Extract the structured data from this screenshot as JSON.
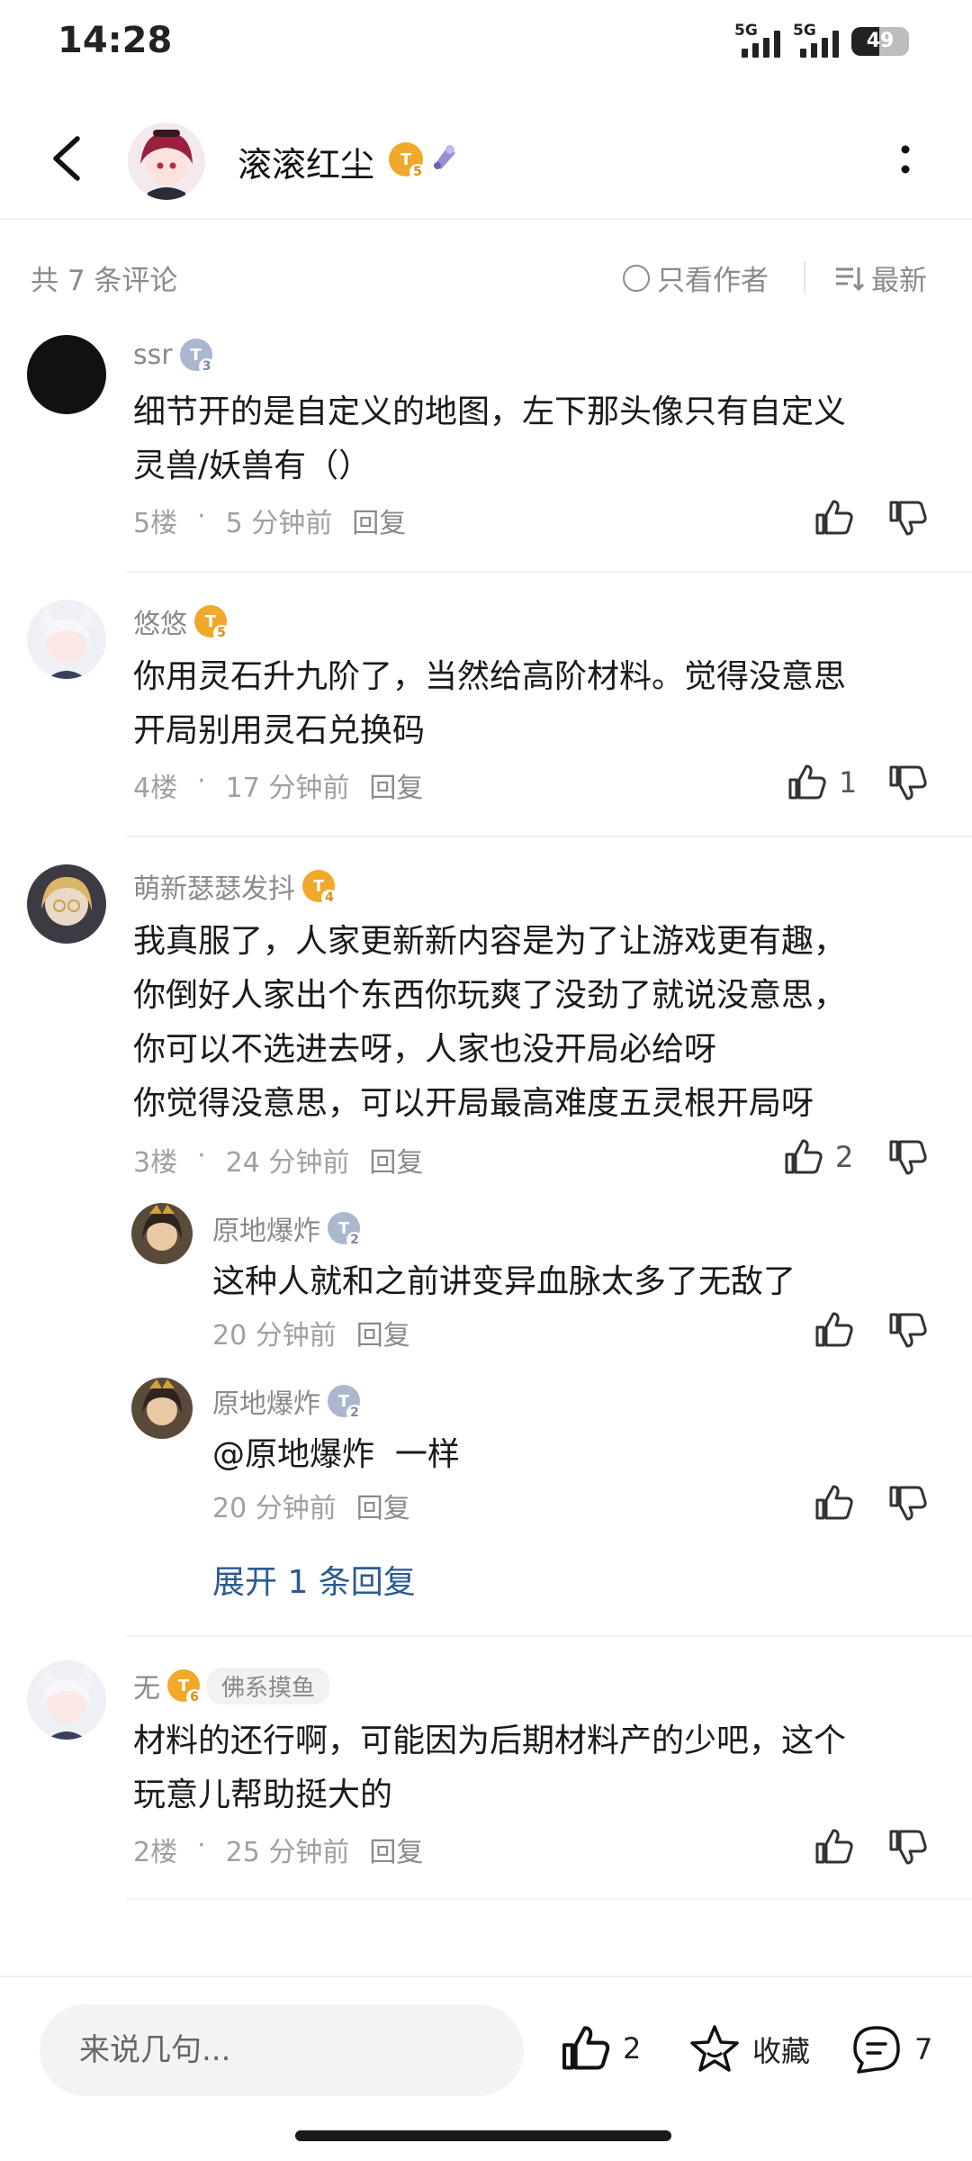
{
  "status_bar": {
    "time": "14:28",
    "signal1_label": "5G",
    "signal2_label": "5G",
    "battery": "49",
    "battery_level": 0.49
  },
  "header": {
    "title": "滚滚红尘",
    "badge_level": "5",
    "back_icon": "chevron-left-icon",
    "more_icon": "more-vertical-icon"
  },
  "filter": {
    "count_label": "共 7 条评论",
    "only_author_label": "只看作者",
    "sort_label": "最新"
  },
  "comments": [
    {
      "username": "ssr",
      "level": "3",
      "level_color": "blue",
      "text_lines": [
        "细节开的是自定义的地图，左下那头像只有自定义",
        "灵兽/妖兽有（）"
      ],
      "floor": "5楼",
      "time": "5 分钟前",
      "reply_label": "回复",
      "likes": ""
    },
    {
      "username": "悠悠",
      "level": "5",
      "level_color": "gold",
      "text_lines": [
        "你用灵石升九阶了，当然给高阶材料。觉得没意思",
        "开局别用灵石兑换码"
      ],
      "floor": "4楼",
      "time": "17 分钟前",
      "reply_label": "回复",
      "likes": "1"
    },
    {
      "username": "萌新瑟瑟发抖",
      "level": "4",
      "level_color": "gold",
      "text_lines": [
        "我真服了，人家更新新内容是为了让游戏更有趣，",
        "你倒好人家出个东西你玩爽了没劲了就说没意思，",
        "你可以不选进去呀，人家也没开局必给呀",
        "你觉得没意思，可以开局最高难度五灵根开局呀"
      ],
      "floor": "3楼",
      "time": "24 分钟前",
      "reply_label": "回复",
      "likes": "2",
      "replies": [
        {
          "username": "原地爆炸",
          "level": "2",
          "text": "这种人就和之前讲变异血脉太多了无敌了",
          "time": "20 分钟前",
          "reply_label": "回复"
        },
        {
          "username": "原地爆炸",
          "level": "2",
          "text": "@原地爆炸  一样",
          "time": "20 分钟前",
          "reply_label": "回复"
        }
      ],
      "expand_label": "展开 1 条回复"
    },
    {
      "username": "无",
      "level": "6",
      "level_color": "gold",
      "tag": "佛系摸鱼",
      "text_lines": [
        "材料的还行啊，可能因为后期材料产的少吧，这个",
        "玩意儿帮助挺大的"
      ],
      "floor": "2楼",
      "time": "25 分钟前",
      "reply_label": "回复",
      "likes": ""
    }
  ],
  "bottom_bar": {
    "input_placeholder": "来说几句...",
    "like_count": "2",
    "favorite_label": "收藏",
    "comment_count": "7"
  },
  "colors": {
    "link_blue": "#2c5a92",
    "gray_text": "#8a8a8a",
    "level_gold": "#f0a92a",
    "level_blue": "#aab7cf"
  }
}
